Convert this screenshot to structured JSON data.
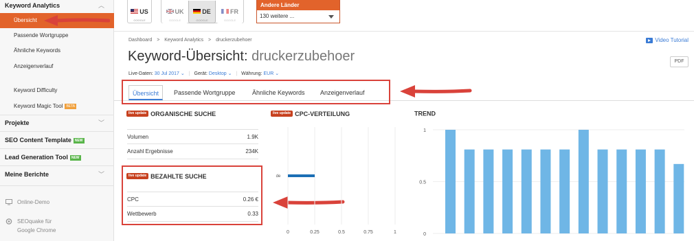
{
  "sidebar": {
    "section_title": "Keyword Analytics",
    "items": [
      {
        "label": "Übersicht",
        "active": true
      },
      {
        "label": "Passende Wortgruppe"
      },
      {
        "label": "Ähnliche Keywords"
      },
      {
        "label": "Anzeigenverlauf"
      },
      {
        "label": "Keyword Difficulty"
      },
      {
        "label": "Keyword Magic Tool",
        "badge": "BETA"
      }
    ],
    "groups": [
      {
        "label": "Projekte"
      },
      {
        "label": "SEO Content Template",
        "badge": "NEW"
      },
      {
        "label": "Lead Generation Tool",
        "badge": "NEW"
      },
      {
        "label": "Meine Berichte"
      }
    ],
    "footer": [
      {
        "label": "Online-Demo"
      },
      {
        "label_line1": "SEOquake für",
        "label_line2": "Google Chrome"
      }
    ]
  },
  "databases": [
    {
      "code": "US",
      "sub": "GOOGLE"
    },
    {
      "code": "UK",
      "sub": "GOOGLE"
    },
    {
      "code": "DE",
      "sub": "GOOGLE",
      "active": true
    },
    {
      "code": "FR",
      "sub": "GOOGLE"
    }
  ],
  "other_countries": {
    "title": "Andere Länder",
    "value": "130 weitere ..."
  },
  "breadcrumb": [
    "Dashboard",
    ">",
    "Keyword Analytics",
    ">",
    "druckerzubehoer"
  ],
  "video_tutorial": "Video Tutorial",
  "page": {
    "title_prefix": "Keyword-Übersicht:",
    "keyword": "druckerzubehoer",
    "pdf": "PDF"
  },
  "meta": {
    "live_label": "Live-Daten:",
    "live_value": "30 Jul 2017",
    "device_label": "Gerät:",
    "device_value": "Desktop",
    "currency_label": "Währung:",
    "currency_value": "EUR"
  },
  "tabs": [
    "Übersicht",
    "Passende Wortgruppe",
    "Ähnliche Keywords",
    "Anzeigenverlauf"
  ],
  "live_update": "live update",
  "organic": {
    "title": "ORGANISCHE SUCHE",
    "rows": [
      {
        "label": "Volumen",
        "value": "1.9K"
      },
      {
        "label": "Anzahl Ergebnisse",
        "value": "234K"
      }
    ]
  },
  "paid": {
    "title": "BEZAHLTE SUCHE",
    "rows": [
      {
        "label": "CPC",
        "value": "0.26 €"
      },
      {
        "label": "Wettbewerb",
        "value": "0.33"
      }
    ]
  },
  "colors": {
    "accent": "#e2632b",
    "link": "#3a7bd5",
    "bar": "#6fb6e6",
    "highlight": "#d9423a"
  },
  "chart_data": [
    {
      "type": "bar",
      "title": "CPC-VERTEILUNG",
      "orientation": "horizontal",
      "categories": [
        "de"
      ],
      "values": [
        0.25
      ],
      "xlim": [
        0,
        1
      ],
      "xticks": [
        "0",
        "0.25",
        "0.5",
        "0.75",
        "1"
      ],
      "color": "#1c6fb5"
    },
    {
      "type": "bar",
      "title": "TREND",
      "values": [
        1.0,
        0.81,
        0.81,
        0.81,
        0.81,
        0.81,
        0.81,
        1.0,
        0.81,
        0.81,
        0.81,
        0.81,
        0.67
      ],
      "ylim": [
        0,
        1
      ],
      "yticks": [
        "1",
        "0.5",
        "0"
      ],
      "color": "#6fb6e6"
    }
  ]
}
